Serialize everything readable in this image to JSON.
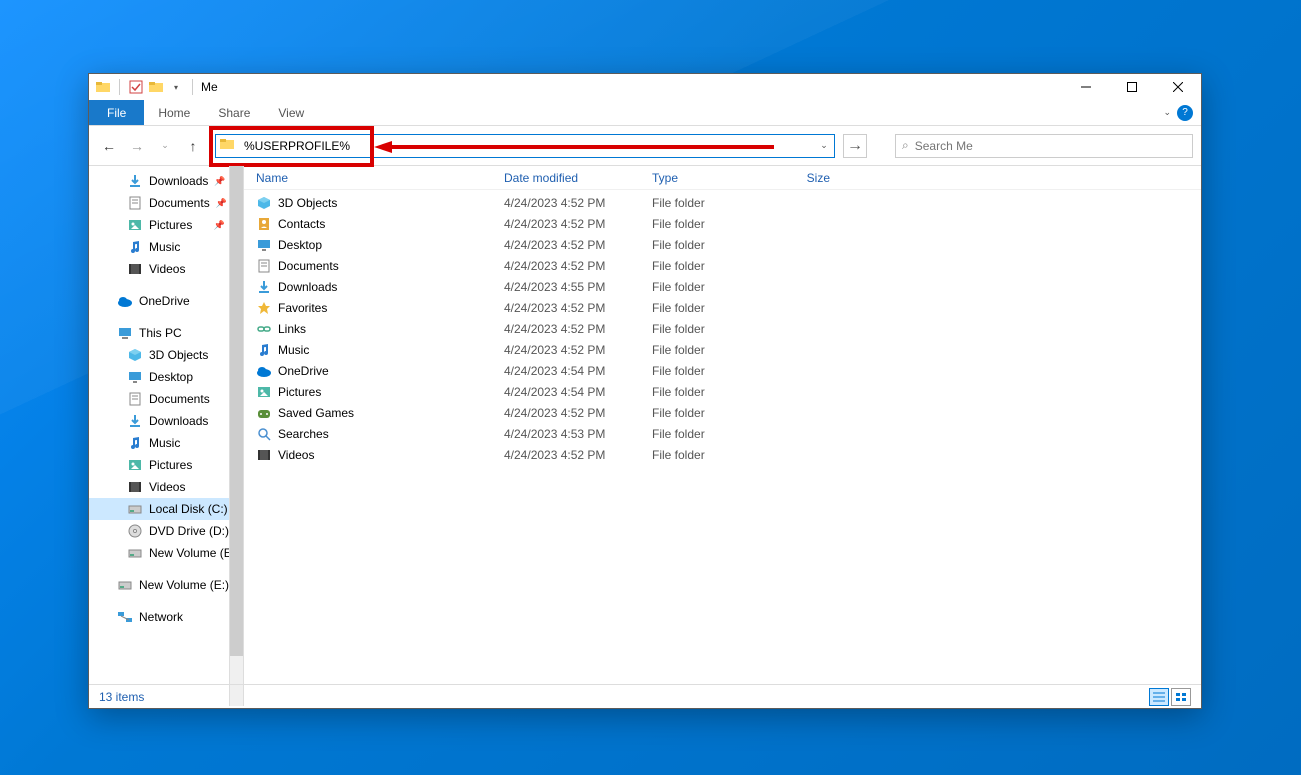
{
  "window_title": "Me",
  "ribbon": {
    "file": "File",
    "home": "Home",
    "share": "Share",
    "view": "View"
  },
  "address_value": "%USERPROFILE%",
  "search_placeholder": "Search Me",
  "columns": {
    "name": "Name",
    "date": "Date modified",
    "type": "Type",
    "size": "Size"
  },
  "sidebar_quick": [
    {
      "label": "Downloads",
      "icon": "download",
      "pinned": true
    },
    {
      "label": "Documents",
      "icon": "doc",
      "pinned": true
    },
    {
      "label": "Pictures",
      "icon": "pic",
      "pinned": true
    },
    {
      "label": "Music",
      "icon": "music",
      "pinned": false
    },
    {
      "label": "Videos",
      "icon": "video",
      "pinned": false
    }
  ],
  "sidebar_onedrive": {
    "label": "OneDrive"
  },
  "sidebar_thispc": {
    "label": "This PC",
    "children": [
      {
        "label": "3D Objects",
        "icon": "3d"
      },
      {
        "label": "Desktop",
        "icon": "desktop"
      },
      {
        "label": "Documents",
        "icon": "doc"
      },
      {
        "label": "Downloads",
        "icon": "download"
      },
      {
        "label": "Music",
        "icon": "music"
      },
      {
        "label": "Pictures",
        "icon": "pic"
      },
      {
        "label": "Videos",
        "icon": "video"
      },
      {
        "label": "Local Disk (C:)",
        "icon": "disk",
        "selected": true
      },
      {
        "label": "DVD Drive (D:) ES",
        "icon": "dvd"
      },
      {
        "label": "New Volume (E:)",
        "icon": "disk"
      }
    ]
  },
  "sidebar_extra": [
    {
      "label": "New Volume (E:)",
      "icon": "disk"
    }
  ],
  "sidebar_network": {
    "label": "Network"
  },
  "files": [
    {
      "name": "3D Objects",
      "icon": "3d",
      "date": "4/24/2023 4:52 PM",
      "type": "File folder"
    },
    {
      "name": "Contacts",
      "icon": "contacts",
      "date": "4/24/2023 4:52 PM",
      "type": "File folder"
    },
    {
      "name": "Desktop",
      "icon": "desktop",
      "date": "4/24/2023 4:52 PM",
      "type": "File folder"
    },
    {
      "name": "Documents",
      "icon": "doc",
      "date": "4/24/2023 4:52 PM",
      "type": "File folder"
    },
    {
      "name": "Downloads",
      "icon": "download",
      "date": "4/24/2023 4:55 PM",
      "type": "File folder"
    },
    {
      "name": "Favorites",
      "icon": "star",
      "date": "4/24/2023 4:52 PM",
      "type": "File folder"
    },
    {
      "name": "Links",
      "icon": "link",
      "date": "4/24/2023 4:52 PM",
      "type": "File folder"
    },
    {
      "name": "Music",
      "icon": "music",
      "date": "4/24/2023 4:52 PM",
      "type": "File folder"
    },
    {
      "name": "OneDrive",
      "icon": "onedrive",
      "date": "4/24/2023 4:54 PM",
      "type": "File folder"
    },
    {
      "name": "Pictures",
      "icon": "pic",
      "date": "4/24/2023 4:54 PM",
      "type": "File folder"
    },
    {
      "name": "Saved Games",
      "icon": "games",
      "date": "4/24/2023 4:52 PM",
      "type": "File folder"
    },
    {
      "name": "Searches",
      "icon": "search",
      "date": "4/24/2023 4:53 PM",
      "type": "File folder"
    },
    {
      "name": "Videos",
      "icon": "video",
      "date": "4/24/2023 4:52 PM",
      "type": "File folder"
    }
  ],
  "status_text": "13 items"
}
